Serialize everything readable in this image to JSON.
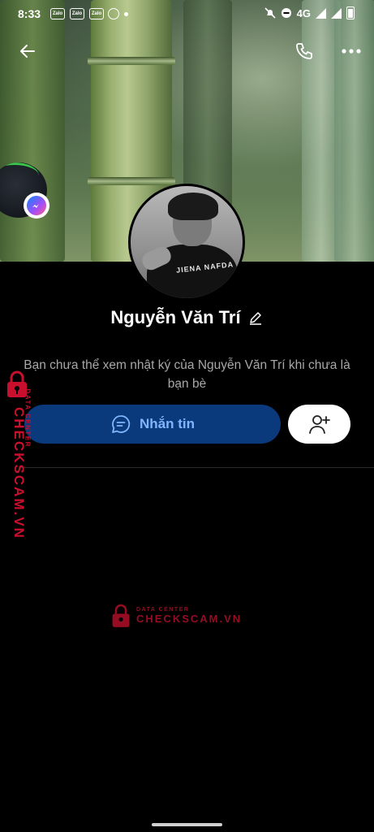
{
  "status_bar": {
    "time": "8:33",
    "app_icons": [
      "Zalo",
      "Zalo",
      "Zalo"
    ],
    "network": "4G"
  },
  "profile": {
    "name": "Nguyễn Văn Trí",
    "avatar_shirt_text": "JIENA NAFDA",
    "notice": "Bạn chưa thể xem nhật ký của Nguyễn Văn Trí khi chưa là bạn bè"
  },
  "actions": {
    "message_label": "Nhắn tin"
  },
  "watermark": {
    "side_title": "CHECKSCAM.VN",
    "side_sub": "DATA CENTER",
    "center_sub": "DATA CENTER",
    "center_title": "CHECKSCAM.VN"
  },
  "colors": {
    "message_button_bg": "#0a3a7b",
    "message_button_text": "#7fb6ff",
    "watermark": "#c8102e"
  }
}
